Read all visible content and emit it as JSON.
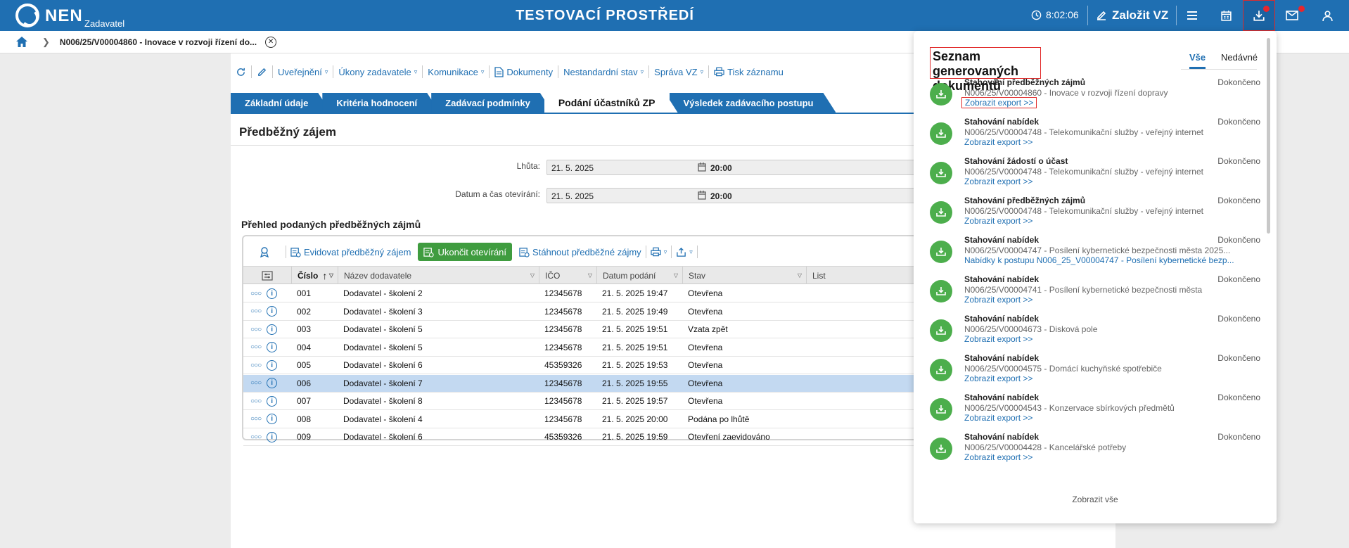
{
  "header": {
    "logo_text": "NEN",
    "logo_sub": "Zadavatel",
    "env_title": "TESTOVACÍ PROSTŘEDÍ",
    "time": "8:02:06",
    "new_vz_label": "Založit VZ",
    "icons": [
      "clock-icon",
      "edit-icon",
      "menu-icon",
      "calendar-icon",
      "download-icon",
      "mail-icon",
      "user-icon"
    ],
    "brand_color": "#1f6fb2"
  },
  "breadcrumb": {
    "title": "N006/25/V00004860 - Inovace v rozvoji řízení do..."
  },
  "toolbar": {
    "items": [
      {
        "label": "",
        "icon": "refresh-icon"
      },
      {
        "label": "",
        "icon": "edit-icon"
      },
      {
        "label": "Uveřejnění",
        "dropdown": true
      },
      {
        "label": "Úkony zadavatele",
        "dropdown": true
      },
      {
        "label": "Komunikace",
        "dropdown": true
      },
      {
        "label": "Dokumenty",
        "icon": "document-icon"
      },
      {
        "label": "Nestandardní stav",
        "dropdown": true
      },
      {
        "label": "Správa VZ",
        "dropdown": true
      },
      {
        "label": "Tisk záznamu",
        "icon": "print-icon"
      }
    ]
  },
  "tabs": [
    {
      "label": "Základní údaje"
    },
    {
      "label": "Kritéria hodnocení"
    },
    {
      "label": "Zadávací podmínky"
    },
    {
      "label": "Podání účastníků ZP",
      "active": true
    },
    {
      "label": "Výsledek zadávacího postupu"
    }
  ],
  "section": {
    "title": "Předběžný zájem",
    "fields": [
      {
        "label": "Lhůta:",
        "date": "21. 5. 2025",
        "time": "20:00"
      },
      {
        "label": "Datum a čas otevírání:",
        "date": "21. 5. 2025",
        "time": "20:00"
      }
    ]
  },
  "overview": {
    "title": "Přehled podaných předběžných zájmů",
    "toolbar": {
      "register_label": "Evidovat předběžný zájem",
      "finish_label": "Ukončit otevírání",
      "download_label": "Stáhnout předběžné zájmy"
    },
    "columns": [
      "Číslo",
      "Název dodavatele",
      "IČO",
      "Datum podání",
      "Stav",
      "List"
    ],
    "rows": [
      {
        "num": "001",
        "name": "Dodavatel - školení 2",
        "ico": "12345678",
        "date": "21. 5. 2025 19:47",
        "state": "Otevřena"
      },
      {
        "num": "002",
        "name": "Dodavatel - školení 3",
        "ico": "12345678",
        "date": "21. 5. 2025 19:49",
        "state": "Otevřena"
      },
      {
        "num": "003",
        "name": "Dodavatel - školení 5",
        "ico": "12345678",
        "date": "21. 5. 2025 19:51",
        "state": "Vzata zpět"
      },
      {
        "num": "004",
        "name": "Dodavatel - školení 5",
        "ico": "12345678",
        "date": "21. 5. 2025 19:51",
        "state": "Otevřena"
      },
      {
        "num": "005",
        "name": "Dodavatel - školení 6",
        "ico": "45359326",
        "date": "21. 5. 2025 19:53",
        "state": "Otevřena"
      },
      {
        "num": "006",
        "name": "Dodavatel - školení 7",
        "ico": "12345678",
        "date": "21. 5. 2025 19:55",
        "state": "Otevřena",
        "selected": true
      },
      {
        "num": "007",
        "name": "Dodavatel - školení 8",
        "ico": "12345678",
        "date": "21. 5. 2025 19:57",
        "state": "Otevřena"
      },
      {
        "num": "008",
        "name": "Dodavatel - školení 4",
        "ico": "12345678",
        "date": "21. 5. 2025 20:00",
        "state": "Podána po lhůtě"
      },
      {
        "num": "009",
        "name": "Dodavatel - školení 6",
        "ico": "45359326",
        "date": "21. 5. 2025 19:59",
        "state": "Otevření zaevidováno"
      }
    ]
  },
  "panel": {
    "title": "Seznam generovaných dokumentů",
    "tab_all": "Vše",
    "tab_recent": "Nedávné",
    "show_all": "Zobrazit vše",
    "items": [
      {
        "title": "Stahování předběžných zájmů",
        "status": "Dokončeno",
        "sub": "N006/25/V00004860 - Inovace v rozvoji řízení dopravy",
        "link": "Zobrazit export >>"
      },
      {
        "title": "Stahování nabídek",
        "status": "Dokončeno",
        "sub": "N006/25/V00004748 - Telekomunikační služby - veřejný internet",
        "link": "Zobrazit export >>"
      },
      {
        "title": "Stahování žádostí o účast",
        "status": "Dokončeno",
        "sub": "N006/25/V00004748 - Telekomunikační služby - veřejný internet",
        "link": "Zobrazit export >>"
      },
      {
        "title": "Stahování předběžných zájmů",
        "status": "Dokončeno",
        "sub": "N006/25/V00004748 - Telekomunikační služby - veřejný internet",
        "link": "Zobrazit export >>"
      },
      {
        "title": "Stahování nabídek",
        "status": "Dokončeno",
        "sub": "N006/25/V00004747 - Posílení kybernetické bezpečnosti města 2025...",
        "link": "Nabídky k postupu N006_25_V00004747 - Posílení kybernetické bezp..."
      },
      {
        "title": "Stahování nabídek",
        "status": "Dokončeno",
        "sub": "N006/25/V00004741 - Posílení kybernetické bezpečnosti města",
        "link": "Zobrazit export >>"
      },
      {
        "title": "Stahování nabídek",
        "status": "Dokončeno",
        "sub": "N006/25/V00004673 - Disková pole",
        "link": "Zobrazit export >>"
      },
      {
        "title": "Stahování nabídek",
        "status": "Dokončeno",
        "sub": "N006/25/V00004575 - Domácí kuchyňské spotřebiče",
        "link": "Zobrazit export >>"
      },
      {
        "title": "Stahování nabídek",
        "status": "Dokončeno",
        "sub": "N006/25/V00004543 - Konzervace sbírkových předmětů",
        "link": "Zobrazit export >>"
      },
      {
        "title": "Stahování nabídek",
        "status": "Dokončeno",
        "sub": "N006/25/V00004428 - Kancelářské potřeby",
        "link": "Zobrazit export >>"
      }
    ]
  }
}
